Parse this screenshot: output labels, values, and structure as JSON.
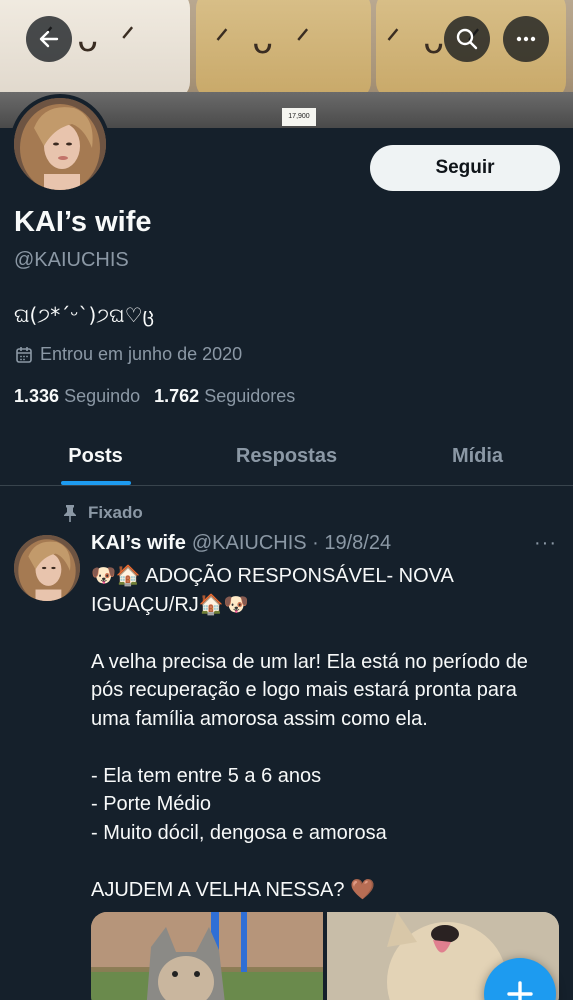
{
  "header": {
    "back_icon": "arrow-left-icon",
    "search_icon": "search-icon",
    "more_icon": "more-horizontal-icon",
    "banner_tag": "17,900"
  },
  "profile": {
    "follow_label": "Seguir",
    "display_name": "KAI’s wife",
    "handle": "@KAIUCHIS",
    "bio": "ଘ(੭*ˊᵕˋ)੭ଘ♡ც",
    "joined": "Entrou em junho de 2020",
    "following_count": "1.336",
    "following_label": "Seguindo",
    "followers_count": "1.762",
    "followers_label": "Seguidores"
  },
  "tabs": [
    {
      "label": "Posts",
      "active": true
    },
    {
      "label": "Respostas",
      "active": false
    },
    {
      "label": "Mídia",
      "active": false
    }
  ],
  "tweet": {
    "pinned_label": "Fixado",
    "author": "KAI’s wife",
    "handle_date": "@KAIUCHIS · 19/8/24",
    "more": "···",
    "body": "🐶🏠 ADOÇÃO RESPONSÁVEL- NOVA IGUAÇU/RJ🏠🐶\n\nA velha precisa de um lar! Ela está no período de pós recuperação e logo mais estará pronta para uma família amorosa assim como ela.\n\n- Ela tem entre 5 a 6 anos\n- Porte Médio\n- Muito dócil, dengosa e amorosa\n\nAJUDEM A VELHA NESSA? 🤎"
  },
  "fab": {
    "label": "+"
  },
  "colors": {
    "background": "#15202b",
    "accent": "#1d9bf0",
    "secondary_text": "#8b98a5",
    "divider": "#38444d"
  }
}
